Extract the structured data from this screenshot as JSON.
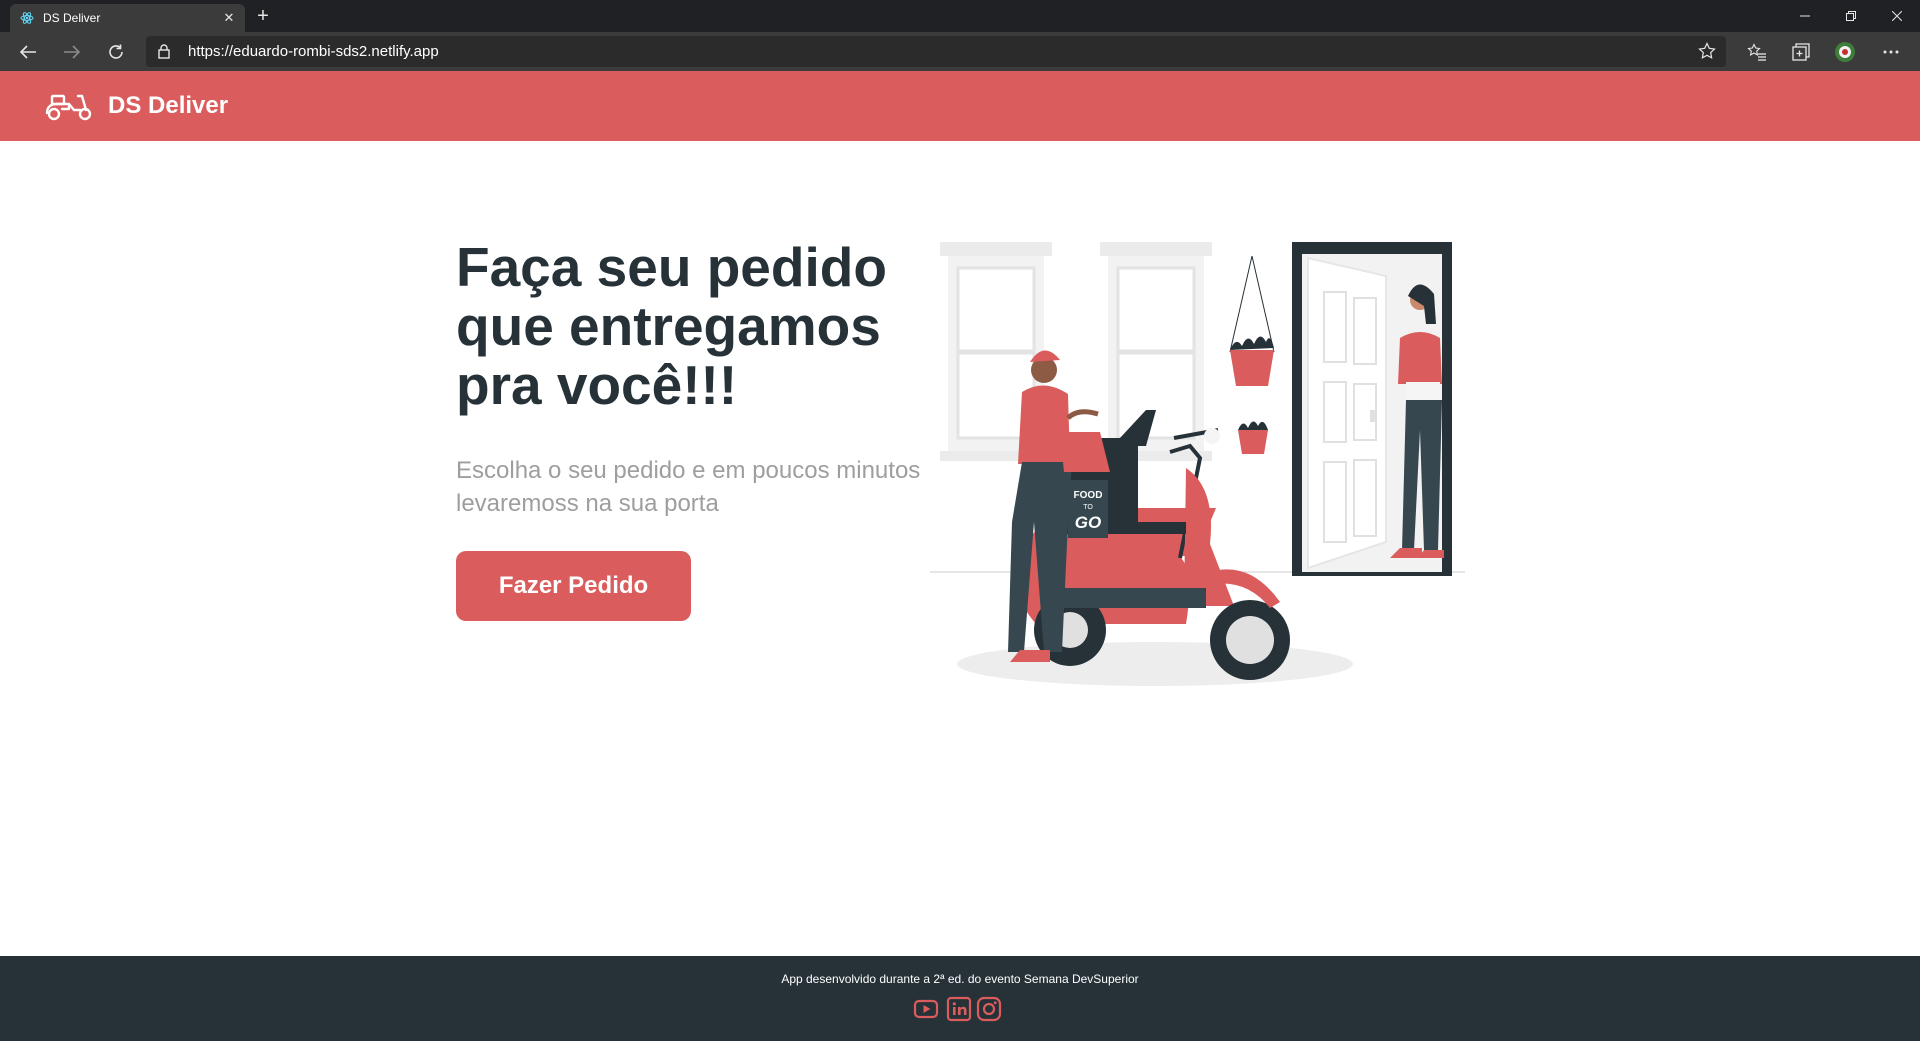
{
  "browser": {
    "tab_title": "DS Deliver",
    "tab_close": "✕",
    "new_tab": "+",
    "url": "https://eduardo-rombi-sds2.netlify.app"
  },
  "app": {
    "brand": "DS Deliver",
    "accent_color": "#da5c5c",
    "dark_color": "#263238"
  },
  "hero": {
    "title": "Faça seu pedido que entregamos pra você!!!",
    "subtitle": "Escolha o seu pedido e em poucos minutos levaremoss na sua porta",
    "button": "Fazer Pedido"
  },
  "illustration": {
    "box_line1": "FOOD",
    "box_line2": "TO",
    "box_line3": "GO"
  },
  "footer": {
    "text": "App desenvolvido durante a 2ª ed. do evento Semana DevSuperior",
    "icons": [
      "youtube-icon",
      "linkedin-icon",
      "instagram-icon"
    ]
  }
}
